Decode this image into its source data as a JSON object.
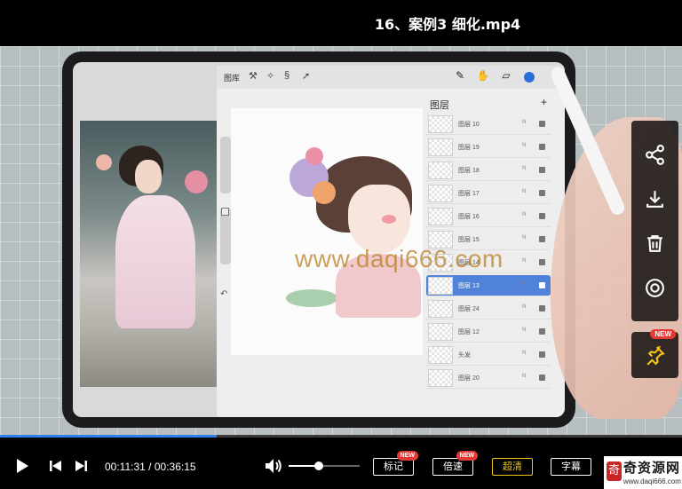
{
  "title": "16、案例3 细化.mp4",
  "procreate": {
    "gallery_label": "图库",
    "layers_title": "图层",
    "layers_add": "+",
    "layers": [
      {
        "name": "图层 10",
        "mode": "N",
        "active": false
      },
      {
        "name": "图层 19",
        "mode": "N",
        "active": false
      },
      {
        "name": "图层 18",
        "mode": "N",
        "active": false
      },
      {
        "name": "图层 17",
        "mode": "N",
        "active": false
      },
      {
        "name": "图层 16",
        "mode": "N",
        "active": false
      },
      {
        "name": "图层 15",
        "mode": "N",
        "active": false
      },
      {
        "name": "图层 14",
        "mode": "N",
        "active": false
      },
      {
        "name": "图层 13",
        "mode": "N",
        "active": true
      },
      {
        "name": "图层 24",
        "mode": "N",
        "active": false
      },
      {
        "name": "图层 12",
        "mode": "N",
        "active": false
      },
      {
        "name": "头发",
        "mode": "N",
        "active": false
      },
      {
        "name": "图层 20",
        "mode": "N",
        "active": false
      }
    ],
    "accent_color": "#4f82d8"
  },
  "watermark": "www.daqi666.com",
  "side_panel": {
    "icons": [
      "share-icon",
      "download-icon",
      "trash-icon",
      "target-icon"
    ],
    "pin_icon": "pin-icon",
    "pin_badge": "NEW"
  },
  "controls": {
    "current_time": "00:11:31",
    "total_time": "00:36:15",
    "time_separator": " / ",
    "progress_fraction": 0.318,
    "volume_fraction": 0.42,
    "buttons": {
      "mark": "标记",
      "speed": "倍速",
      "quality": "超清",
      "subtitle": "字幕"
    },
    "new_badge": "NEW",
    "progress_color": "#2e7ff0",
    "quality_color": "#f2c418"
  },
  "logo": {
    "name": "奇资源网",
    "url": "www.daqi666.com",
    "mark": "奇"
  }
}
